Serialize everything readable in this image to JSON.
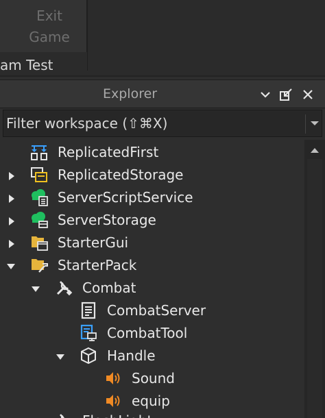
{
  "ribbon": {
    "exit_line1": "Exit",
    "exit_line2": "Game",
    "team_test": "am Test"
  },
  "explorer": {
    "title": "Explorer",
    "filter_placeholder": "Filter workspace (⇧⌘X)",
    "header_icons": [
      "chevron-down-icon",
      "undock-icon",
      "close-icon"
    ]
  },
  "tree": [
    {
      "label": "ReplicatedFirst",
      "icon": "replicated-first-icon",
      "depth": 0,
      "arrow": "none"
    },
    {
      "label": "ReplicatedStorage",
      "icon": "replicated-storage-icon",
      "depth": 0,
      "arrow": "collapsed"
    },
    {
      "label": "ServerScriptService",
      "icon": "server-script-service-icon",
      "depth": 0,
      "arrow": "collapsed"
    },
    {
      "label": "ServerStorage",
      "icon": "server-storage-icon",
      "depth": 0,
      "arrow": "collapsed"
    },
    {
      "label": "StarterGui",
      "icon": "starter-gui-icon",
      "depth": 0,
      "arrow": "collapsed"
    },
    {
      "label": "StarterPack",
      "icon": "starter-pack-icon",
      "depth": 0,
      "arrow": "expanded"
    },
    {
      "label": "Combat",
      "icon": "tool-icon",
      "depth": 1,
      "arrow": "expanded"
    },
    {
      "label": "CombatServer",
      "icon": "script-icon",
      "depth": 2,
      "arrow": "none"
    },
    {
      "label": "CombatTool",
      "icon": "local-script-icon",
      "depth": 2,
      "arrow": "none"
    },
    {
      "label": "Handle",
      "icon": "part-icon",
      "depth": 2,
      "arrow": "expanded"
    },
    {
      "label": "Sound",
      "icon": "sound-icon",
      "depth": 3,
      "arrow": "none"
    },
    {
      "label": "equip",
      "icon": "sound-icon",
      "depth": 3,
      "arrow": "none"
    },
    {
      "label": "FlashLight",
      "icon": "tool-icon",
      "depth": 1,
      "arrow": "expanded"
    }
  ],
  "colors": {
    "accent_blue": "#3aa0ff",
    "server_green": "#1fbf5f",
    "storage_yellow": "#f0c020",
    "folder_yellow": "#e6b43c",
    "sound_orange": "#f08a24"
  }
}
